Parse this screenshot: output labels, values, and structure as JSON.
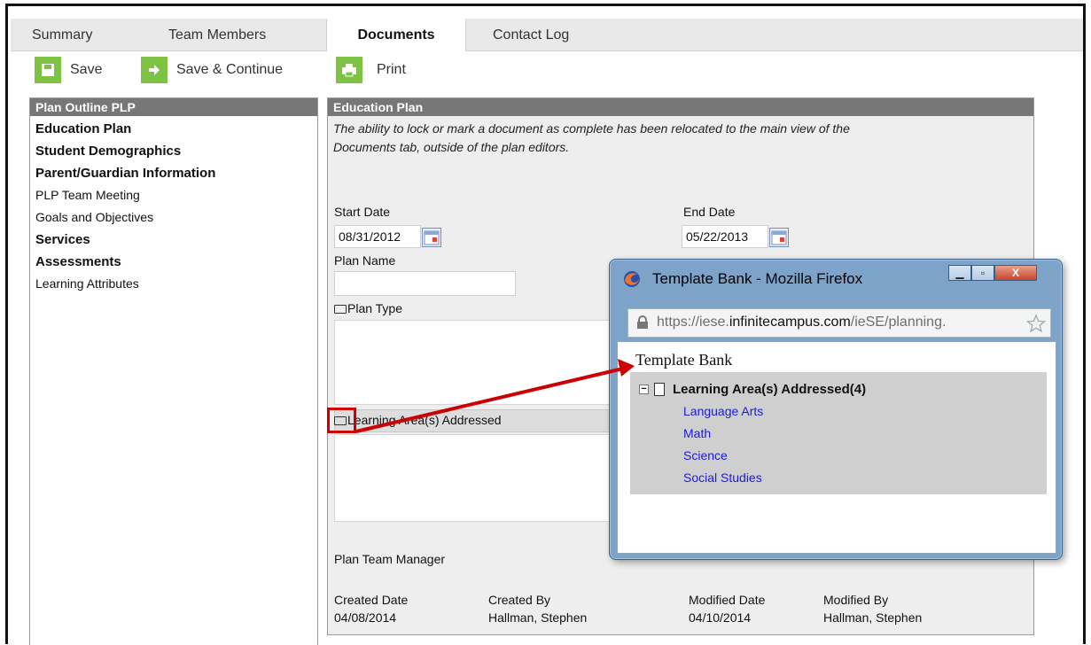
{
  "tabs": [
    {
      "label": "Summary",
      "active": false
    },
    {
      "label": "Team Members",
      "active": false
    },
    {
      "label": "Documents",
      "active": true
    },
    {
      "label": "Contact Log",
      "active": false
    }
  ],
  "toolbar": {
    "save_label": "Save",
    "save_continue_label": "Save & Continue",
    "print_label": "Print"
  },
  "outline": {
    "header": "Plan Outline PLP",
    "items": [
      {
        "label": "Education Plan",
        "bold": true
      },
      {
        "label": "Student Demographics",
        "bold": true
      },
      {
        "label": "Parent/Guardian Information",
        "bold": true
      },
      {
        "label": "PLP Team Meeting",
        "bold": false
      },
      {
        "label": "Goals and Objectives",
        "bold": false
      },
      {
        "label": "Services",
        "bold": true
      },
      {
        "label": "Assessments",
        "bold": true
      },
      {
        "label": "Learning Attributes",
        "bold": false
      }
    ]
  },
  "main": {
    "header": "Education Plan",
    "note_line1": "The ability to lock or mark a document as complete has been relocated to the main view of the",
    "note_line2": "Documents tab, outside of the plan editors.",
    "start_date_label": "Start Date",
    "start_date_value": "08/31/2012",
    "end_date_label": "End Date",
    "end_date_value": "05/22/2013",
    "plan_name_label": "Plan Name",
    "plan_name_value": "",
    "plan_type_label": "Plan Type",
    "learning_area_label": "Learning Area(s) Addressed",
    "team_manager_label": "Plan Team Manager",
    "created_date_label": "Created Date",
    "created_date_value": "04/08/2014",
    "created_by_label": "Created By",
    "created_by_value": "Hallman, Stephen",
    "modified_date_label": "Modified Date",
    "modified_date_value": "04/10/2014",
    "modified_by_label": "Modified By",
    "modified_by_value": "Hallman, Stephen"
  },
  "popup": {
    "title": "Template Bank - Mozilla Firefox",
    "url_prefix": "https://iese.",
    "url_domain": "infinitecampus.com",
    "url_suffix": "/ieSE/planning.",
    "content_title": "Template Bank",
    "tree_header": "Learning Area(s) Addressed(4)",
    "tree_items": [
      "Language Arts",
      "Math",
      "Science",
      "Social Studies"
    ]
  },
  "colors": {
    "accent_green": "#7dc242",
    "header_gray": "#777777",
    "callout_red": "#cc0000",
    "link_blue": "#1c1cd8"
  }
}
